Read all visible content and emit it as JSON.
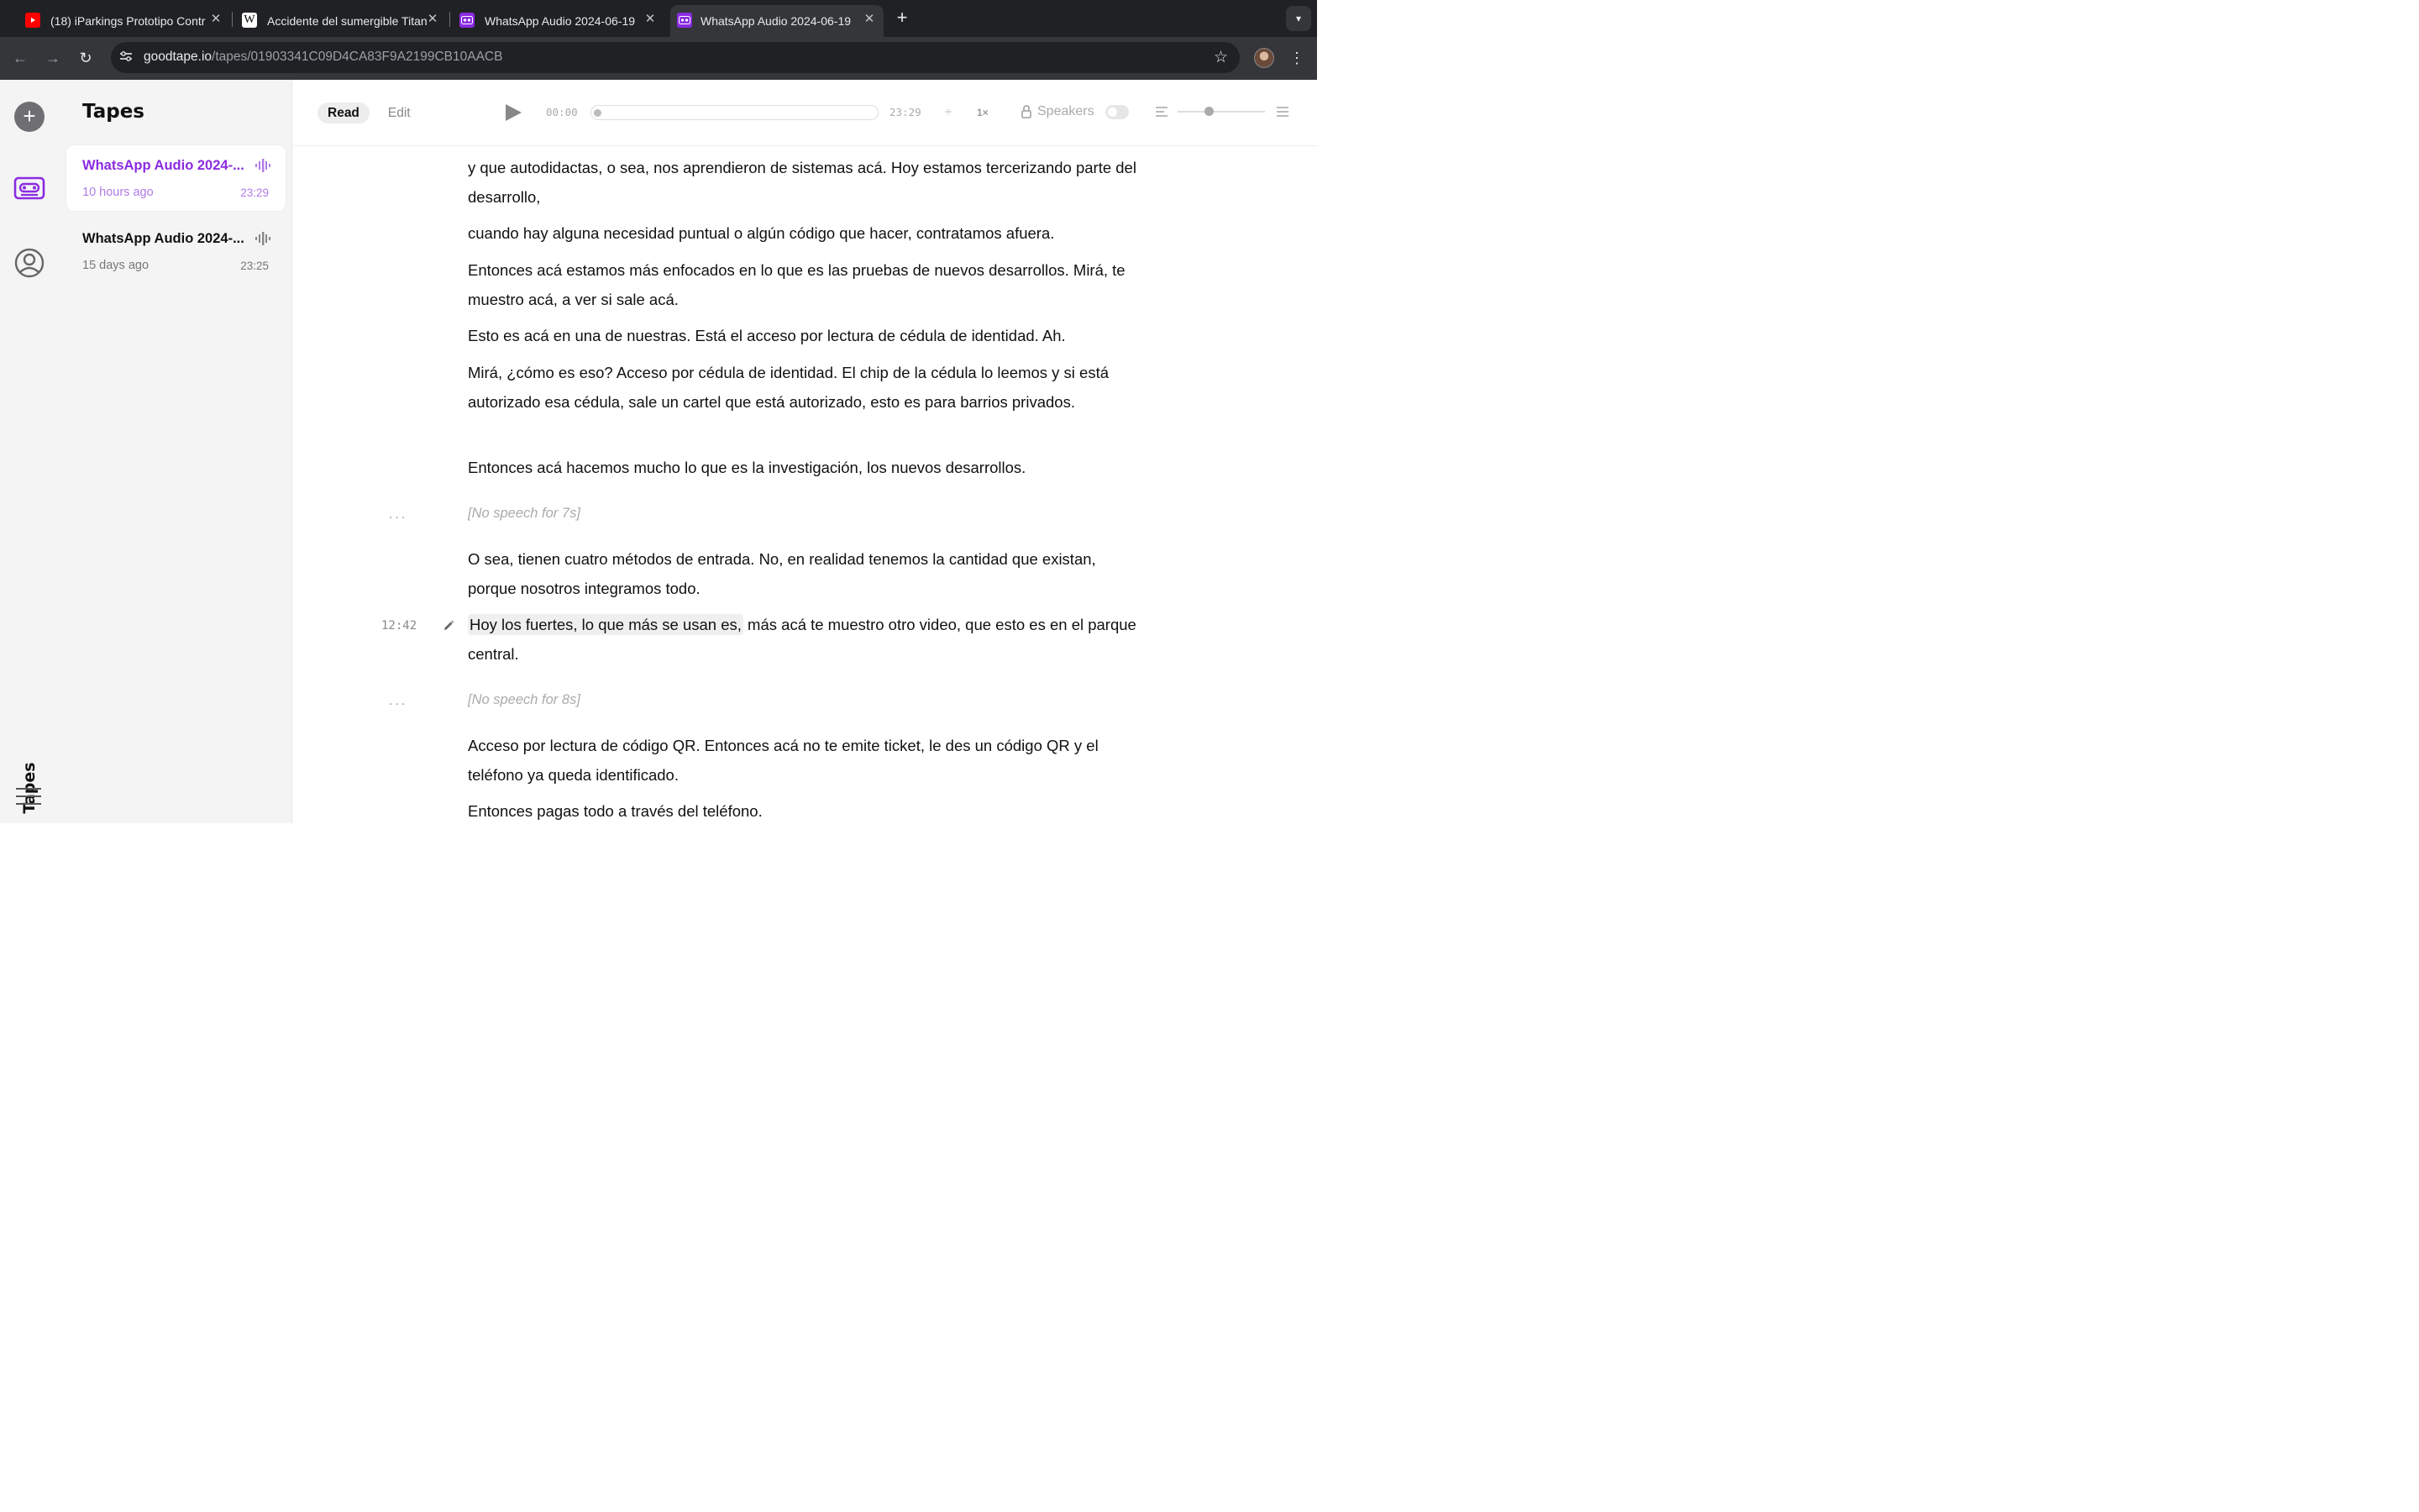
{
  "browser": {
    "tabs": [
      {
        "title": "(18) iParkings Prototipo Contr",
        "icon": "youtube-icon"
      },
      {
        "title": "Accidente del sumergible Titan",
        "icon": "wikipedia-icon"
      },
      {
        "title": "WhatsApp Audio 2024-06-19",
        "icon": "goodtape-icon"
      },
      {
        "title": "WhatsApp Audio 2024-06-19",
        "icon": "goodtape-icon"
      }
    ],
    "url_host": "goodtape.io",
    "url_path": "/tapes/01903341C09D4CA83F9A2199CB10AACB"
  },
  "sidebar": {
    "title": "Tapes",
    "brand": "Tapes",
    "tapes": [
      {
        "name": "WhatsApp Audio 2024-...",
        "age": "10 hours ago",
        "duration": "23:29"
      },
      {
        "name": "WhatsApp Audio 2024-...",
        "age": "15 days ago",
        "duration": "23:25"
      }
    ]
  },
  "player": {
    "read_label": "Read",
    "edit_label": "Edit",
    "current_time": "00:00",
    "total_time": "23:29",
    "speed": "1×",
    "speakers_label": "Speakers",
    "progress": 0
  },
  "transcript": {
    "p1": "y que autodidactas, o sea, nos aprendieron de sistemas acá. Hoy estamos tercerizando parte del desarrollo,",
    "p2": "cuando hay alguna necesidad puntual o algún código que hacer, contratamos afuera.",
    "p3": "Entonces acá estamos más enfocados en lo que es las pruebas de nuevos desarrollos. Mirá, te muestro acá, a ver si sale acá.",
    "p4": "Esto es acá en una de nuestras. Está el acceso por lectura de cédula de identidad. Ah.",
    "p5": "Mirá, ¿cómo es eso? Acceso por cédula de identidad. El chip de la cédula lo leemos y si está autorizado esa cédula, sale un cartel que está autorizado, esto es para barrios privados.",
    "p6": "Entonces acá hacemos mucho lo que es la investigación, los nuevos desarrollos.",
    "gap1_dots": "...",
    "gap1": "[No speech for 7s]",
    "p7": "O sea, tienen cuatro métodos de entrada. No, en realidad tenemos la cantidad que existan, porque nosotros integramos todo.",
    "p8_time": "12:42",
    "p8_highlight": "Hoy los fuertes, lo que más se usan es,",
    "p8_rest": " más acá te muestro otro video, que esto es en el parque central.",
    "gap2_dots": "...",
    "gap2": "[No speech for 8s]",
    "p9": "Acceso por lectura de código QR. Entonces acá no te emite ticket, le des un código QR y el teléfono ya queda identificado.",
    "p10": "Entonces pagas todo a través del teléfono."
  },
  "colors": {
    "accent": "#8a2be2",
    "accent_light": "#b07be8",
    "chrome_dark": "#202124",
    "chrome_mid": "#35363a",
    "panel_bg": "#f4f4f5"
  }
}
